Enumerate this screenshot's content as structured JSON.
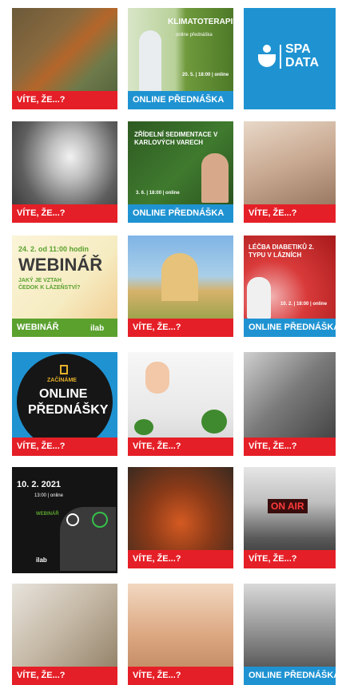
{
  "tiles": [
    {
      "caption": "VÍTE, ŽE...?",
      "color": "#e51f27"
    },
    {
      "caption": "ONLINE PŘEDNÁŠKA",
      "color": "#1f93d2",
      "headline": "KLIMATOTERAPIE",
      "sub": "online přednáška",
      "meta": "20. 5. | 18:00 | online"
    },
    {
      "brand_line1": "SPA",
      "brand_line2": "DATA",
      "color": "#1f93d2"
    },
    {
      "caption": "VÍTE, ŽE...?",
      "color": "#e51f27"
    },
    {
      "caption": "ONLINE PŘEDNÁŠKA",
      "color": "#1f93d2",
      "headline": "ZŘÍDELNÍ SEDIMENTACE V KARLOVÝCH VARECH",
      "meta": "3. 6. | 18:00 | online"
    },
    {
      "caption": "VÍTE, ŽE...?",
      "color": "#e51f27"
    },
    {
      "caption": "WEBINÁŘ",
      "color": "#5aa12e",
      "date": "24. 2. od 11:00 hodin",
      "headline": "WEBINÁŘ",
      "sub": "JAKÝ JE VZTAH ČEDOK K LÁZEŇSTVÍ?",
      "brand": "ilab"
    },
    {
      "caption": "VÍTE, ŽE...?",
      "color": "#e51f27"
    },
    {
      "caption": "ONLINE PŘEDNÁŠKA",
      "color": "#1f93d2",
      "headline": "LÉČBA DIABETIKŮ 2. TYPU V LÁZNÍCH",
      "meta": "10. 2. | 18:00 | online"
    },
    {
      "caption": "VÍTE, ŽE...?",
      "color": "#e51f27",
      "top": "ZAČÍNÁME",
      "headline1": "ONLINE",
      "headline2": "PŘEDNÁŠKY"
    },
    {
      "caption": "VÍTE, ŽE...?",
      "color": "#e51f27"
    },
    {
      "caption": "VÍTE, ŽE...?",
      "color": "#e51f27"
    },
    {
      "date": "10. 2. 2021",
      "time": "13:00 | online",
      "label": "WEBINÁŘ",
      "brand": "ilab"
    },
    {
      "caption": "VÍTE, ŽE...?",
      "color": "#e51f27"
    },
    {
      "caption": "VÍTE, ŽE...?",
      "color": "#e51f27",
      "onair": "ON AIR"
    },
    {
      "caption": "VÍTE, ŽE...?",
      "color": "#e51f27"
    },
    {
      "caption": "VÍTE, ŽE...?",
      "color": "#e51f27"
    },
    {
      "caption": "ONLINE PŘEDNÁŠKA",
      "color": "#1f93d2"
    }
  ]
}
